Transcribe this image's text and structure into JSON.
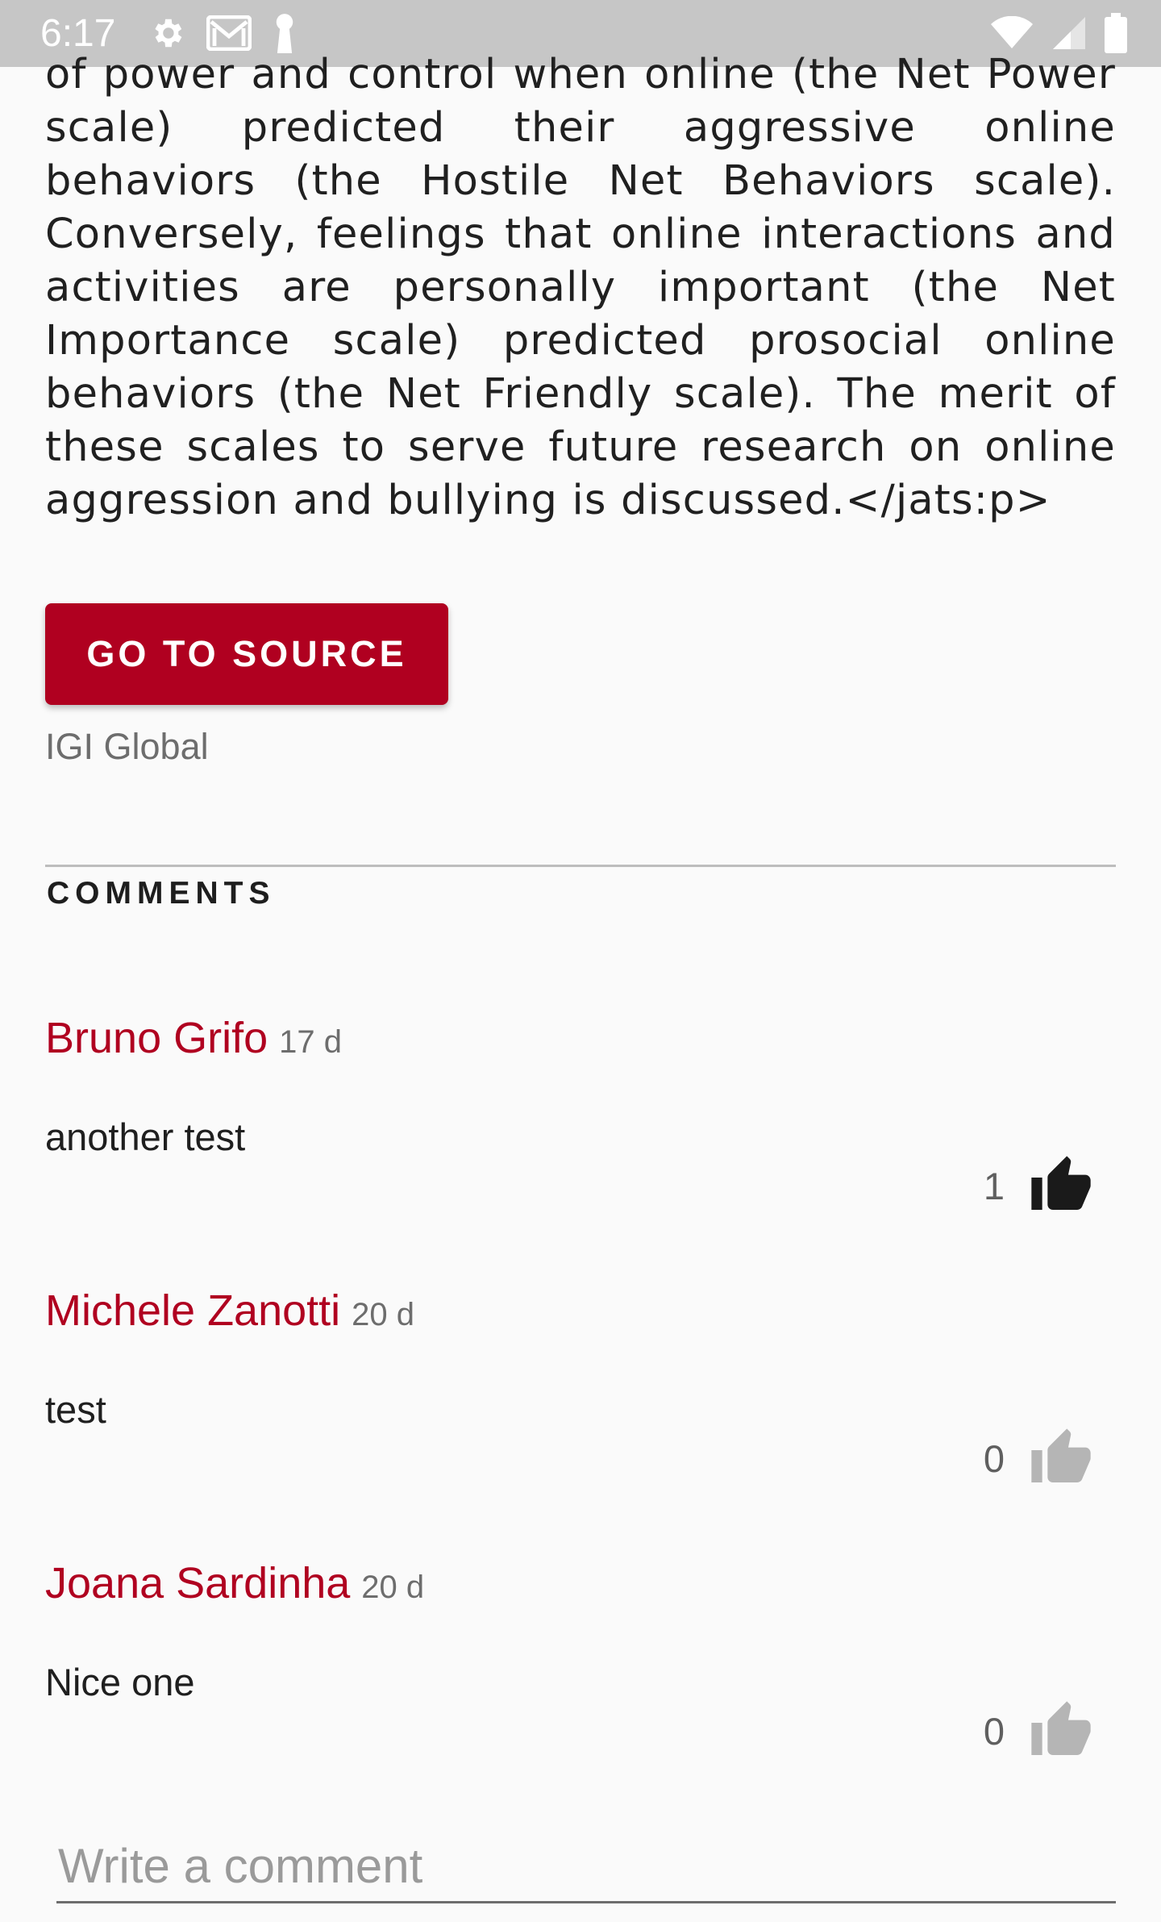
{
  "status_bar": {
    "time": "6:17",
    "icons_left": [
      "gear-icon",
      "gmail-icon",
      "key-icon"
    ],
    "icons_right": [
      "wifi-icon",
      "cell-signal-icon",
      "battery-icon"
    ]
  },
  "article": {
    "abstract_tail": "of power and control when online (the Net Power scale) predicted their aggressive online behaviors (the Hostile Net Behaviors scale). Conversely, feelings that online interactions and activities are personally important (the Net Importance scale) predicted prosocial online behaviors (the Net Friendly scale). The merit of these scales to serve future research on online aggression and bullying is discussed.</jats:p>",
    "source_button_label": "GO TO SOURCE",
    "source_name": "IGI Global"
  },
  "comments": {
    "heading": "COMMENTS",
    "items": [
      {
        "author": "Bruno Grifo",
        "age": "17 d",
        "text": "another test",
        "likes": "1",
        "liked": true
      },
      {
        "author": "Michele Zanotti",
        "age": "20 d",
        "text": "test",
        "likes": "0",
        "liked": false
      },
      {
        "author": "Joana Sardinha",
        "age": "20 d",
        "text": "Nice one",
        "likes": "0",
        "liked": false
      }
    ],
    "input_placeholder": "Write a comment"
  },
  "colors": {
    "accent": "#b00020",
    "status_bar": "#c6c6c6",
    "liked_icon": "#1a1a1a",
    "unliked_icon": "#b5b5b5"
  }
}
